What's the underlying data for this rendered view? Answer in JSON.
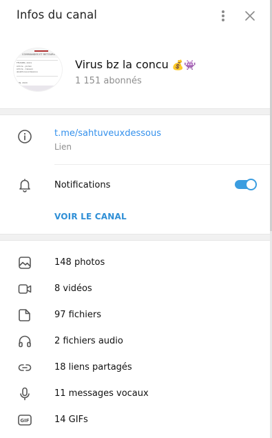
{
  "header": {
    "title": "Infos du canal"
  },
  "profile": {
    "name": "Virus bz la concu",
    "emojis": "💰👾",
    "subscribers": "1 151 abonnés",
    "avatar_text": {
      "heading": "COMMANDES ET RETOURS",
      "line1": "FÉVRIER, 2021",
      "line2": "Article - Jordan",
      "line3": "Article - Caisson",
      "line4": "@sahtuveuxdessous",
      "footer": "JUIN, 2020"
    }
  },
  "info": {
    "link": "t.me/sahtuveuxdessous",
    "link_label": "Lien",
    "notifications_label": "Notifications",
    "notifications_enabled": true,
    "view_channel": "VOIR LE CANAL"
  },
  "media": [
    {
      "icon": "photo-icon",
      "label": "148 photos"
    },
    {
      "icon": "video-icon",
      "label": "8 vidéos"
    },
    {
      "icon": "file-icon",
      "label": "97 fichiers"
    },
    {
      "icon": "headphones-icon",
      "label": "2 fichiers audio"
    },
    {
      "icon": "link-icon",
      "label": "18 liens partagés"
    },
    {
      "icon": "microphone-icon",
      "label": "11 messages vocaux"
    },
    {
      "icon": "gif-icon",
      "label": "14 GIFs"
    }
  ],
  "colors": {
    "accent": "#3390ec",
    "toggle": "#3a9de0",
    "secondary_text": "#8e8e8e"
  }
}
